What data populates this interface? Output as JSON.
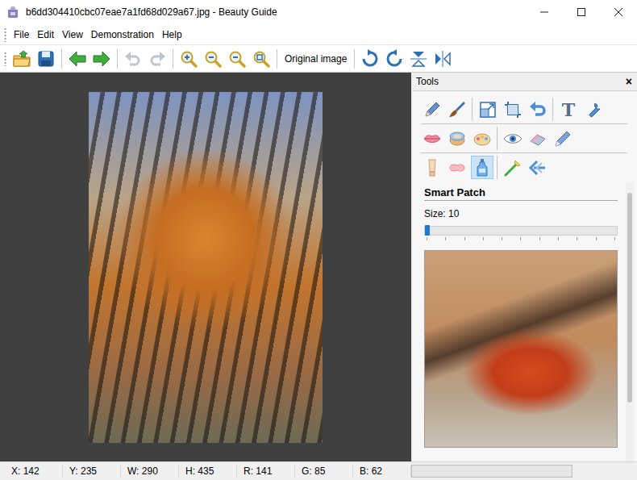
{
  "window": {
    "title": "b6dd304410cbc07eae7a1fd68d029a67.jpg - Beauty Guide"
  },
  "menu": [
    "File",
    "Edit",
    "View",
    "Demonstration",
    "Help"
  ],
  "toolbar": [
    {
      "kind": "button",
      "disabled": false
    },
    {
      "kind": "button",
      "disabled": false
    },
    {
      "kind": "separator"
    },
    {
      "kind": "button",
      "disabled": false
    },
    {
      "kind": "button",
      "disabled": false
    },
    {
      "kind": "separator"
    },
    {
      "kind": "button",
      "disabled": true
    },
    {
      "kind": "button",
      "disabled": true
    },
    {
      "kind": "separator"
    },
    {
      "kind": "button",
      "disabled": false
    },
    {
      "kind": "button",
      "disabled": false
    },
    {
      "kind": "button",
      "disabled": false
    },
    {
      "kind": "button",
      "disabled": false
    },
    {
      "kind": "separator"
    },
    {
      "kind": "text",
      "label": "Original image"
    },
    {
      "kind": "separator"
    },
    {
      "kind": "button",
      "disabled": false
    },
    {
      "kind": "button",
      "disabled": false
    },
    {
      "kind": "button",
      "disabled": false
    },
    {
      "kind": "button",
      "disabled": false
    }
  ],
  "tools_panel": {
    "title": "Tools",
    "close": "×",
    "tool_rows": [
      {
        "groups": [
          [
            {
              "selected": false
            },
            {
              "selected": false
            }
          ],
          [
            {
              "selected": false
            },
            {
              "selected": false
            },
            {
              "selected": false
            }
          ],
          [
            {
              "selected": false,
              "glyph": "T"
            },
            {
              "selected": false
            }
          ]
        ]
      },
      {
        "groups": [
          [
            {
              "selected": false
            },
            {
              "selected": false
            },
            {
              "selected": false
            }
          ],
          [
            {
              "selected": false
            },
            {
              "selected": false
            },
            {
              "selected": false
            }
          ]
        ]
      },
      {
        "groups": [
          [
            {
              "selected": false
            },
            {
              "selected": false
            },
            {
              "selected": true
            }
          ],
          [
            {
              "selected": false
            },
            {
              "selected": false
            }
          ]
        ]
      }
    ],
    "active_tool": "Smart Patch",
    "size_label": "Size: 10",
    "size_level": 0.0
  },
  "status_bar": {
    "cells": [
      "X: 142",
      "Y: 235",
      "W: 290",
      "H: 435",
      "R: 141",
      "G: 85",
      "B: 62"
    ],
    "progress_level": 0
  }
}
